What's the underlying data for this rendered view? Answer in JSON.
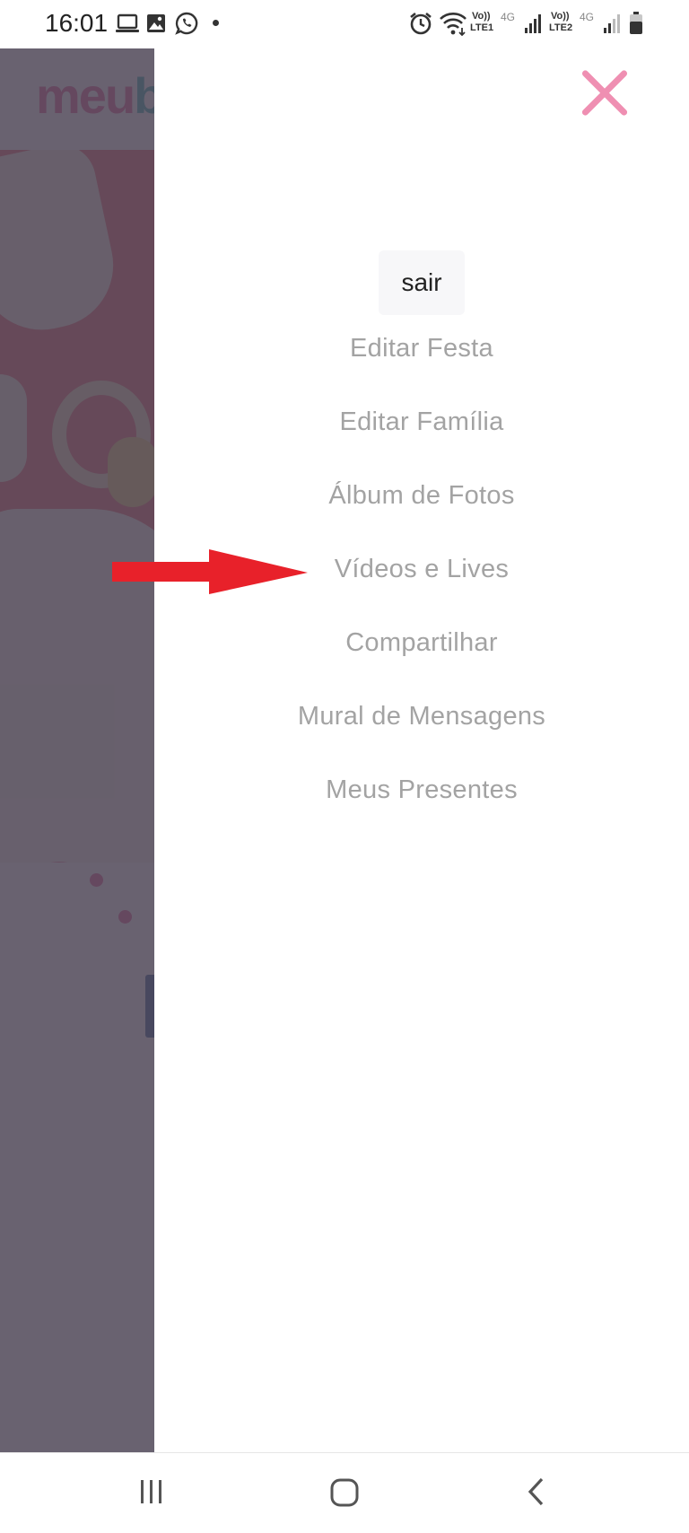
{
  "status_bar": {
    "time": "16:01",
    "icons": [
      "laptop-icon",
      "image-icon",
      "whatsapp-icon",
      "dot-icon",
      "alarm-icon",
      "wifi-icon",
      "signal-icon",
      "battery-icon"
    ],
    "sim1_label_top": "Vo))",
    "sim1_label_bottom": "LTE1",
    "sim1_network": "4G",
    "sim2_label_top": "Vo))",
    "sim2_label_bottom": "LTE2",
    "sim2_network": "4G"
  },
  "background": {
    "logo_pink": "meu",
    "logo_teal": "b"
  },
  "drawer": {
    "logout_label": "sair",
    "menu_items": [
      {
        "label": "Editar Festa"
      },
      {
        "label": "Editar Família"
      },
      {
        "label": "Álbum de Fotos"
      },
      {
        "label": "Vídeos e Lives"
      },
      {
        "label": "Compartilhar"
      },
      {
        "label": "Mural de Mensagens"
      },
      {
        "label": "Meus Presentes"
      }
    ]
  },
  "annotation": {
    "arrow_color": "#e8212a",
    "points_to": "Vídeos e Lives"
  },
  "colors": {
    "brand_pink": "#e0488a",
    "brand_teal": "#1fa6a6",
    "close_icon": "#ef8fb2",
    "menu_text": "#a3a3a3"
  },
  "nav_bar": {
    "buttons": [
      "recent-apps-icon",
      "home-icon",
      "back-icon"
    ]
  }
}
